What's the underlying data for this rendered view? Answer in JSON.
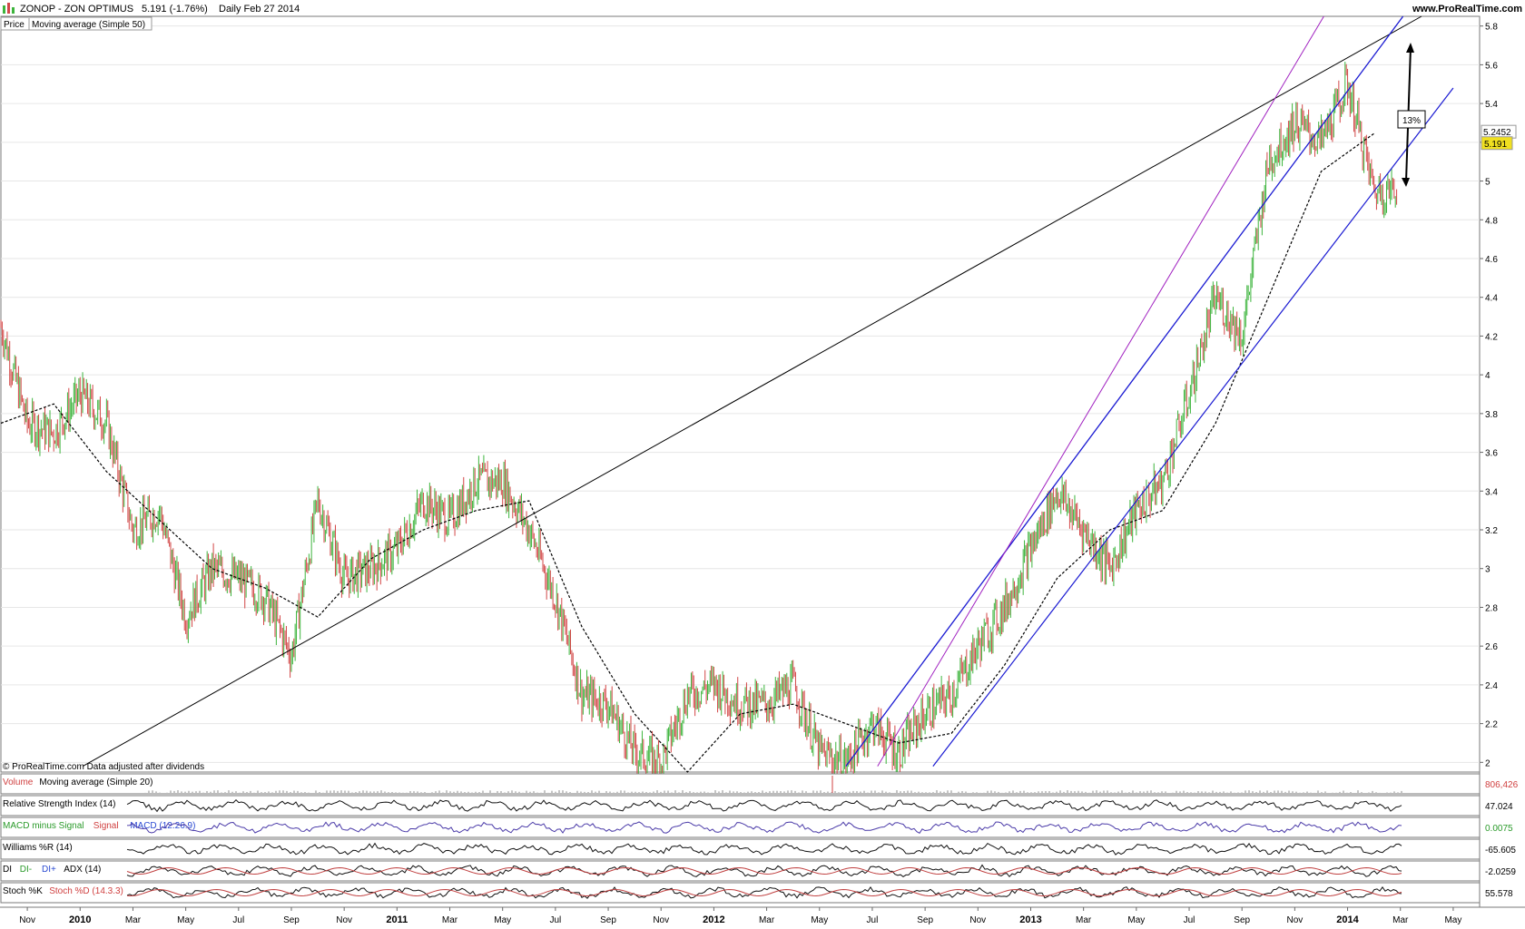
{
  "header": {
    "symbol": "ZONOP - ZON OPTIMUS",
    "quote": "5.191 (-1.76%)",
    "period": "Daily  Feb 27 2014",
    "site": "www.ProRealTime.com"
  },
  "main": {
    "legend_price": "Price",
    "legend_ma": "Moving average (Simple 50)",
    "footer_note": "© ProRealTime.com Data adjusted after dividends",
    "ma_label": "5.2452",
    "price_label": "5.191",
    "pct_box": "13%"
  },
  "indicators": [
    {
      "key": "volume",
      "labels": [
        "Volume",
        "Moving average (Simple 20)"
      ],
      "value": "806,426",
      "value_color": "#d04040"
    },
    {
      "key": "rsi",
      "labels": [
        "Relative Strength Index (14)"
      ],
      "value": "47.024",
      "value_color": "#000000"
    },
    {
      "key": "macd",
      "labels": [
        "MACD minus Signal",
        "Signal",
        "MACD (12.26.9)"
      ],
      "value": "0.0075",
      "value_color": "#2a9a2a"
    },
    {
      "key": "willr",
      "labels": [
        "Williams %R (14)"
      ],
      "value": "-65.605",
      "value_color": "#000000"
    },
    {
      "key": "dmi",
      "labels": [
        "DI",
        "DI-",
        "DI+",
        "ADX (14)"
      ],
      "value": "-2.0259",
      "value_color": "#000000"
    },
    {
      "key": "stoch",
      "labels": [
        "Stoch %K",
        "Stoch %D (14.3.3)"
      ],
      "value": "55.578",
      "value_color": "#000000"
    }
  ],
  "colors": {
    "up_candle": "#3cb43c",
    "down_candle": "#d24646",
    "ma_line": "#000000",
    "channel": "#1a1ad2",
    "channel_purple": "#a020c0",
    "trendline": "#000000",
    "price_tag": "#f0e020"
  },
  "chart_data": {
    "type": "line",
    "title": "ZONOP - ZON OPTIMUS",
    "ylim": [
      1.95,
      5.85
    ],
    "yticks": [
      2,
      2.2,
      2.4,
      2.6,
      2.8,
      3,
      3.2,
      3.4,
      3.6,
      3.8,
      4,
      4.2,
      4.4,
      4.6,
      4.8,
      5,
      5.2,
      5.4,
      5.6,
      5.8
    ],
    "x_tick_labels": [
      "Nov",
      "2010",
      "Mar",
      "May",
      "Jul",
      "Sep",
      "Nov",
      "2011",
      "Mar",
      "May",
      "Jul",
      "Sep",
      "Nov",
      "2012",
      "Mar",
      "May",
      "Jul",
      "Sep",
      "Nov",
      "2013",
      "Mar",
      "May",
      "Jul",
      "Sep",
      "Nov",
      "2014",
      "Mar",
      "May"
    ],
    "x_tick_bold": [
      "2010",
      "2011",
      "2012",
      "2013",
      "2014"
    ],
    "series": [
      {
        "name": "Price",
        "x": [
          "Oct 2009",
          "Nov 2009",
          "Dec 2009",
          "Jan 2010",
          "Feb 2010",
          "Mar 2010",
          "Apr 2010",
          "May 2010",
          "Jun 2010",
          "Jul 2010",
          "Aug 2010",
          "Sep 2010",
          "Oct 2010",
          "Nov 2010",
          "Dec 2010",
          "Jan 2011",
          "Feb 2011",
          "Mar 2011",
          "Apr 2011",
          "May 2011",
          "Jun 2011",
          "Jul 2011",
          "Aug 2011",
          "Sep 2011",
          "Oct 2011",
          "Nov 2011",
          "Dec 2011",
          "Jan 2012",
          "Feb 2012",
          "Mar 2012",
          "Apr 2012",
          "May 2012",
          "Jun 2012",
          "Jul 2012",
          "Aug 2012",
          "Sep 2012",
          "Oct 2012",
          "Nov 2012",
          "Dec 2012",
          "Jan 2013",
          "Feb 2013",
          "Mar 2013",
          "Apr 2013",
          "May 2013",
          "Jun 2013",
          "Jul 2013",
          "Aug 2013",
          "Sep 2013",
          "Oct 2013",
          "Nov 2013",
          "Dec 2013",
          "Jan 2014",
          "Feb 2014"
        ],
        "values": [
          4.25,
          3.75,
          3.7,
          3.9,
          3.75,
          3.2,
          3.3,
          2.75,
          3.0,
          2.95,
          2.85,
          2.55,
          3.35,
          2.95,
          3.0,
          3.1,
          3.35,
          3.25,
          3.45,
          3.45,
          3.2,
          2.85,
          2.35,
          2.3,
          2.05,
          2.0,
          2.35,
          2.4,
          2.3,
          2.3,
          2.4,
          2.05,
          2.0,
          2.2,
          2.05,
          2.25,
          2.35,
          2.6,
          2.8,
          3.1,
          3.4,
          3.2,
          3.0,
          3.3,
          3.45,
          3.9,
          4.4,
          4.2,
          5.1,
          5.3,
          5.2,
          5.5,
          4.95
        ]
      },
      {
        "name": "Moving average (Simple 50)",
        "x": [
          "Oct 2009",
          "Dec 2009",
          "Feb 2010",
          "Apr 2010",
          "Jun 2010",
          "Aug 2010",
          "Oct 2010",
          "Dec 2010",
          "Feb 2011",
          "Apr 2011",
          "Jun 2011",
          "Aug 2011",
          "Oct 2011",
          "Dec 2011",
          "Feb 2012",
          "Apr 2012",
          "Jun 2012",
          "Aug 2012",
          "Oct 2012",
          "Dec 2012",
          "Feb 2013",
          "Apr 2013",
          "Jun 2013",
          "Aug 2013",
          "Oct 2013",
          "Dec 2013",
          "Feb 2014"
        ],
        "values": [
          3.75,
          3.85,
          3.5,
          3.25,
          3.0,
          2.9,
          2.75,
          3.05,
          3.2,
          3.3,
          3.35,
          2.7,
          2.25,
          1.95,
          2.25,
          2.3,
          2.2,
          2.1,
          2.15,
          2.5,
          2.95,
          3.2,
          3.3,
          3.75,
          4.4,
          5.05,
          5.2452
        ]
      }
    ],
    "current_price": 5.191,
    "current_ma": 5.2452,
    "annotation": {
      "text": "13%",
      "from": 5.72,
      "to": 5.0
    }
  }
}
